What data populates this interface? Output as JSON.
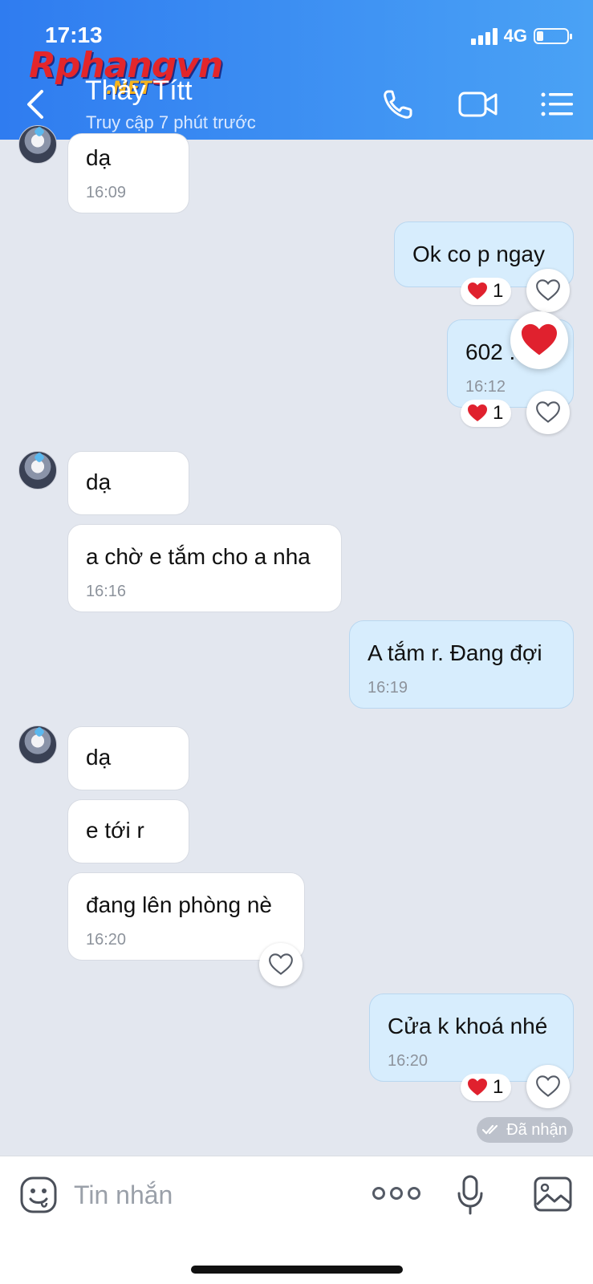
{
  "status_bar": {
    "time": "17:13",
    "network": "4G"
  },
  "watermark": {
    "brand": "Rphangvn",
    "suffix": ".NET"
  },
  "header": {
    "contact_name": "Thảy Títt",
    "last_seen": "Truy cập 7 phút trước"
  },
  "messages": [
    {
      "text": "dạ",
      "time": "16:09"
    },
    {
      "text": "Ok co p ngay",
      "reaction_count": "1"
    },
    {
      "text": "602 .",
      "time": "16:12",
      "reaction_count": "1"
    },
    {
      "text": "dạ"
    },
    {
      "text": "a chờ e tắm cho a nha",
      "time": "16:16"
    },
    {
      "text": "A tắm r. Đang đợi",
      "time": "16:19"
    },
    {
      "text": "dạ"
    },
    {
      "text": "e tới r"
    },
    {
      "text": "đang lên phòng nè",
      "time": "16:20"
    },
    {
      "text": "Cửa k khoá nhé",
      "time": "16:20",
      "reaction_count": "1"
    }
  ],
  "delivery_status": "Đã nhận",
  "input": {
    "placeholder": "Tin nhắn"
  },
  "colors": {
    "header_start": "#2f7cf0",
    "header_end": "#4aa2f5",
    "outgoing_bubble": "#d7edfd",
    "heart": "#e0212e"
  }
}
